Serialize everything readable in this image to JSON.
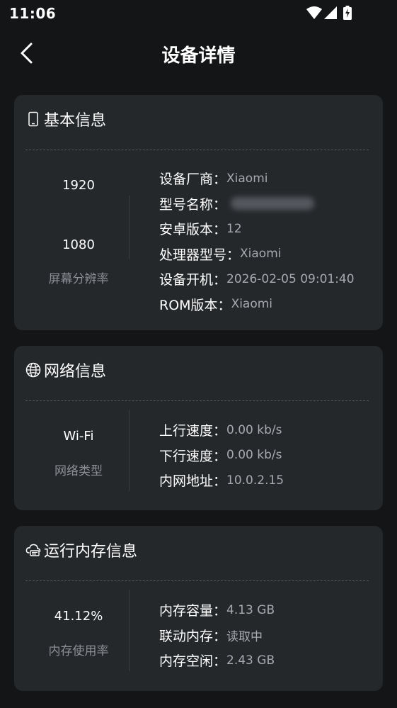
{
  "status_bar": {
    "time": "11:06",
    "icons": [
      "wifi-icon",
      "signal-icon",
      "battery-charging-icon"
    ]
  },
  "app_bar": {
    "title": "设备详情",
    "back_icon": "chevron-left-icon"
  },
  "basic_info": {
    "title": "基本信息",
    "icon": "phone-icon",
    "resolution_width": "1920",
    "resolution_height": "1080",
    "resolution_label": "屏幕分辨率",
    "rows": [
      {
        "key": "设备厂商：",
        "value": "Xiaomi"
      },
      {
        "key": "型号名称：",
        "value": ""
      },
      {
        "key": "安卓版本：",
        "value": "12"
      },
      {
        "key": "处理器型号：",
        "value": "Xiaomi"
      },
      {
        "key": "设备开机：",
        "value": "2026-02-05 09:01:40"
      },
      {
        "key": "ROM版本：",
        "value": "Xiaomi"
      }
    ]
  },
  "network_info": {
    "title": "网络信息",
    "icon": "globe-icon",
    "type_value": "Wi-Fi",
    "type_label": "网络类型",
    "rows": [
      {
        "key": "上行速度：",
        "value": "0.00 kb/s"
      },
      {
        "key": "下行速度：",
        "value": "0.00 kb/s"
      },
      {
        "key": "内网地址：",
        "value": "10.0.2.15"
      }
    ]
  },
  "memory_info": {
    "title": "运行内存信息",
    "icon": "cloud-memory-icon",
    "usage_value": "41.12%",
    "usage_label": "内存使用率",
    "rows": [
      {
        "key": "内存容量：",
        "value": "4.13 GB"
      },
      {
        "key": "联动内存：",
        "value": "读取中"
      },
      {
        "key": "内存空闲：",
        "value": "2.43 GB"
      }
    ]
  },
  "colors": {
    "background": "#141516",
    "card": "#25282b",
    "secondary_text": "#a6aaaf"
  }
}
